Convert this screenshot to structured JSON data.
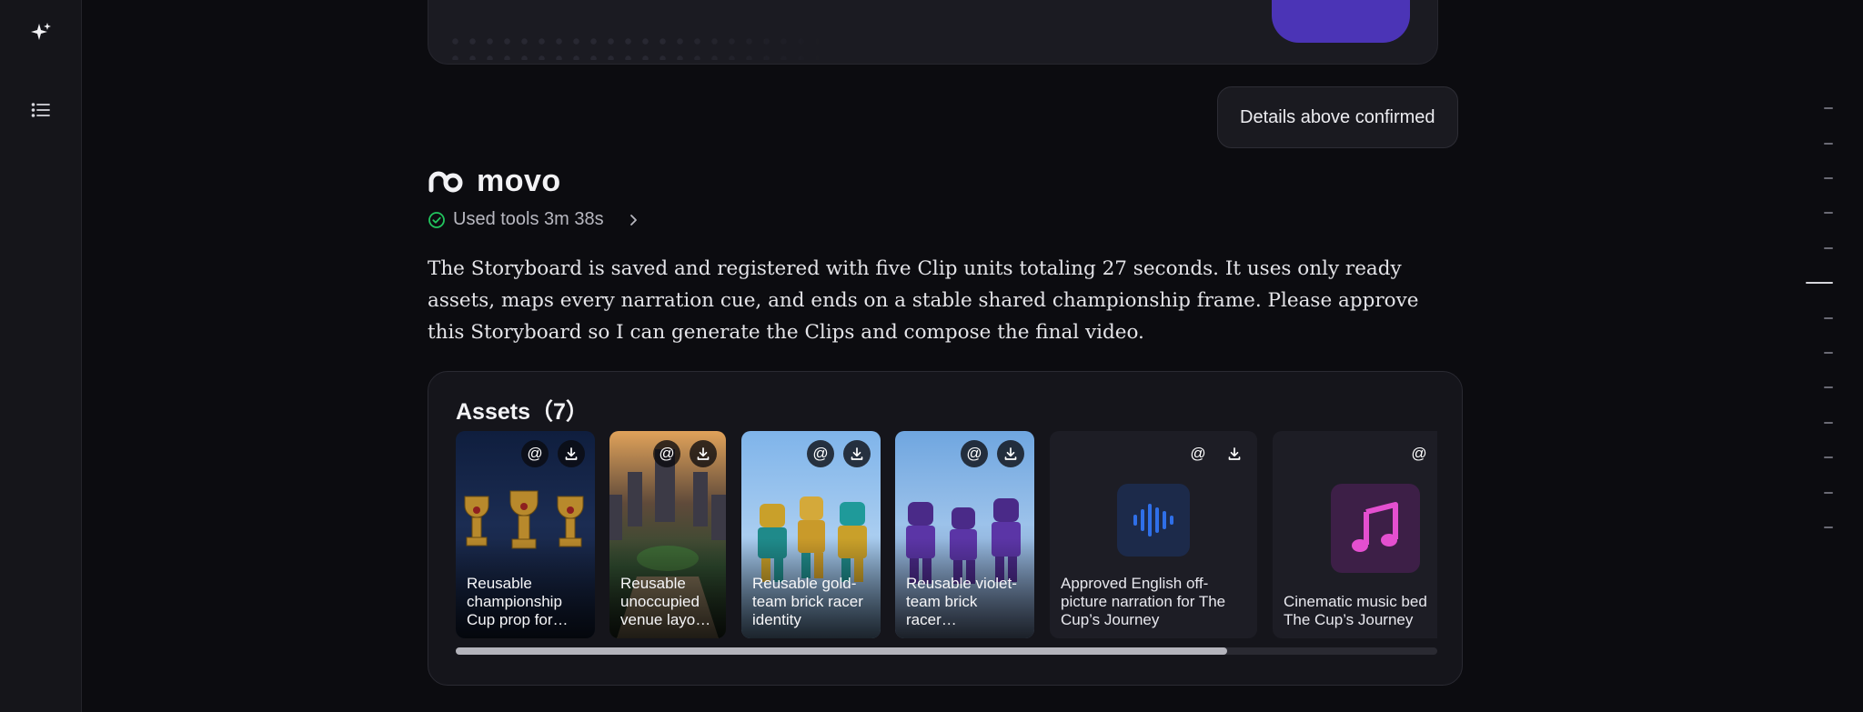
{
  "sidebar": {
    "top_icon": "sparkles-icon",
    "nav_icon": "list-icon"
  },
  "confirmation": {
    "text": "Details above confirmed"
  },
  "brand": {
    "name": "movo"
  },
  "tools": {
    "label": "Used tools 3m 38s"
  },
  "message": {
    "text": "The Storyboard is saved and registered with five Clip units totaling 27 seconds. It uses only ready assets, maps every narration cue, and ends on a stable shared championship frame. Please approve this Storyboard so I can generate the Clips and compose the final video."
  },
  "assets": {
    "title": "Assets（7）",
    "mention_glyph": "@",
    "items": [
      {
        "caption": "Reusable championship Cup prop for…",
        "kind": "image"
      },
      {
        "caption": "Reusable unoccupied venue layo…",
        "kind": "image"
      },
      {
        "caption": "Reusable gold-team brick racer identity",
        "kind": "image"
      },
      {
        "caption": "Reusable violet-team brick racer…",
        "kind": "image"
      },
      {
        "caption": "Approved English off-picture narration for The Cup’s Journey",
        "kind": "audio"
      },
      {
        "caption": "Cinematic music bed The Cup’s Journey",
        "kind": "music"
      }
    ],
    "scroll_fraction": 0.786
  },
  "colors": {
    "accent_purple": "#4b34b6",
    "success_green": "#22c55e",
    "audio_blue": "#2f6fe8",
    "music_pink": "#e44fd0"
  }
}
